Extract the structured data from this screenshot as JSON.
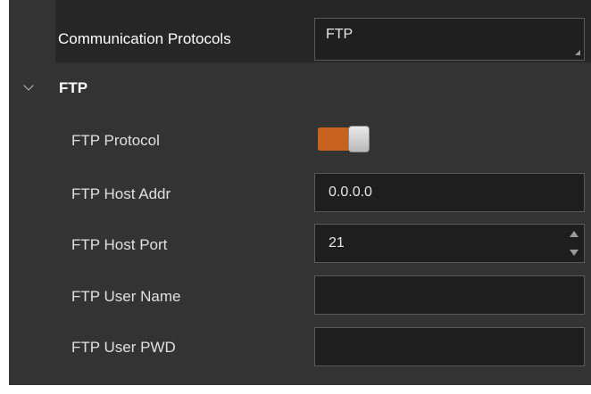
{
  "communication": {
    "label": "Communication Protocols",
    "selected": "FTP"
  },
  "ftp_section": {
    "title": "FTP",
    "chevron_icon": "chevron-down-icon"
  },
  "fields": {
    "protocol": {
      "label": "FTP Protocol",
      "enabled": true
    },
    "host_addr": {
      "label": "FTP Host Addr",
      "value": "0.0.0.0"
    },
    "host_port": {
      "label": "FTP Host Port",
      "value": "21"
    },
    "user_name": {
      "label": "FTP User Name",
      "value": ""
    },
    "user_pwd": {
      "label": "FTP User PWD",
      "value": ""
    }
  },
  "colors": {
    "panel_bg": "#333333",
    "field_bg": "#1e1e1e",
    "toggle_on": "#c8611e"
  }
}
